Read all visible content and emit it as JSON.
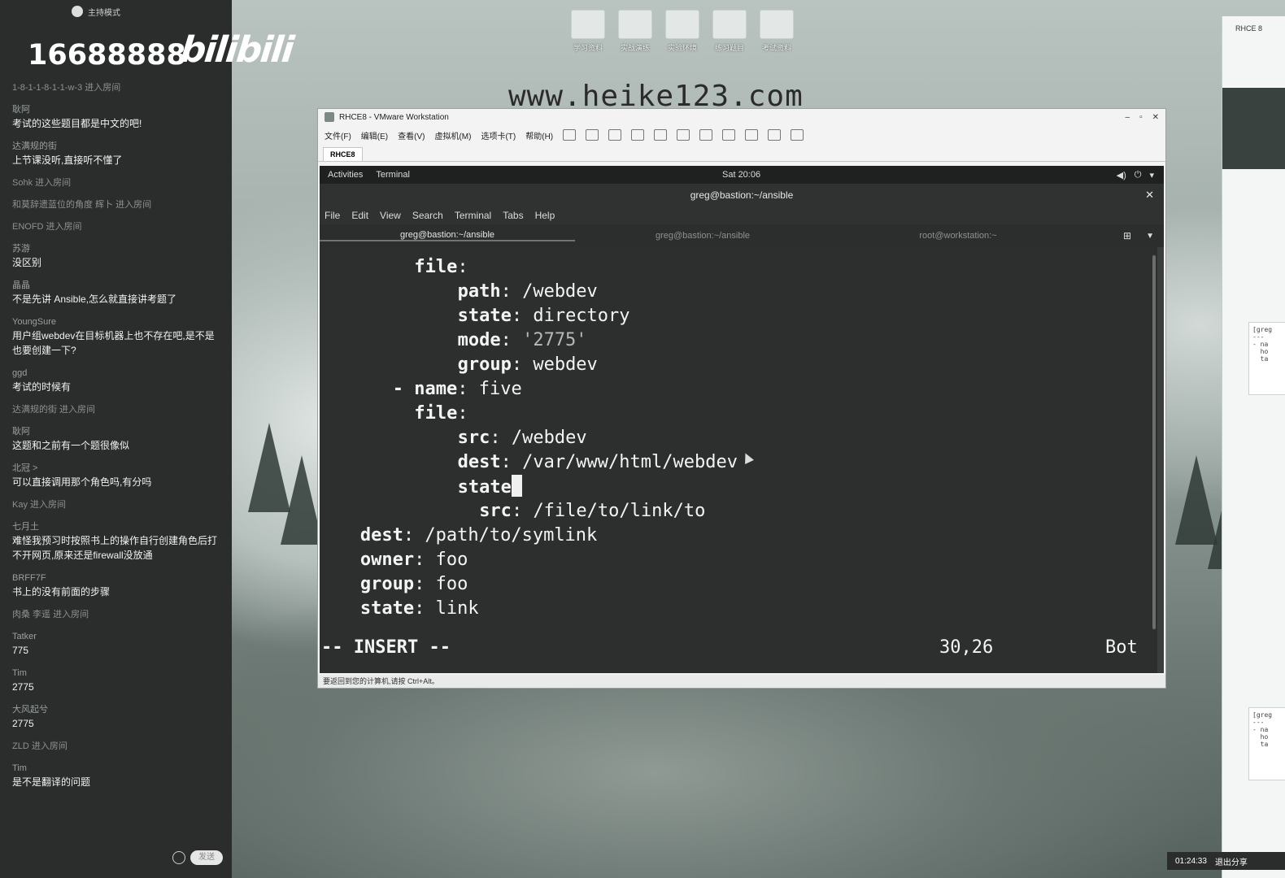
{
  "overlay": {
    "number": "16688888",
    "logo": "bilibili",
    "watermark": "www.heike123.com"
  },
  "chat_panel": {
    "top_title": "主持模式",
    "messages": [
      {
        "user": "1-8-1-1-8-1-1-w-3 进入房间",
        "text": ""
      },
      {
        "user": "耿阿",
        "text": "考试的这些题目都是中文的吧!"
      },
      {
        "user": "达满规的街",
        "text": "上节课没听,直接听不懂了"
      },
      {
        "user": "Sohk 进入房间",
        "text": ""
      },
      {
        "user": "和莫辞遗蓝位的角度 辉卜 进入房间",
        "text": ""
      },
      {
        "user": "ENOFD 进入房间",
        "text": ""
      },
      {
        "user": "苏游",
        "text": "没区别"
      },
      {
        "user": "晶晶",
        "text": "不是先讲 Ansible,怎么就直接讲考题了"
      },
      {
        "user": "YoungSure",
        "text": "用户组webdev在目标机器上也不存在吧,是不是也要创建一下?"
      },
      {
        "user": "ggd",
        "text": "考试的时候有"
      },
      {
        "user": "达满规的街 进入房间",
        "text": ""
      },
      {
        "user": "耿阿",
        "text": "这题和之前有一个题很像似"
      },
      {
        "user": "北冠 >",
        "text": "可以直接调用那个角色吗,有分吗"
      },
      {
        "user": "Kay 进入房间",
        "text": ""
      },
      {
        "user": "七月土",
        "text": "难怪我预习时按照书上的操作自行创建角色后打不开网页,原来还是firewall没放通"
      },
      {
        "user": "BRFF7F",
        "text": "书上的没有前面的步骤"
      },
      {
        "user": "肉桑 李遥 进入房间",
        "text": ""
      },
      {
        "user": "Tatker",
        "text": "775"
      },
      {
        "user": "Tim",
        "text": "2775"
      },
      {
        "user": "大风起兮",
        "text": "2775"
      },
      {
        "user": "ZLD 进入房间",
        "text": ""
      },
      {
        "user": "Tim",
        "text": "是不是翻译的问题"
      }
    ],
    "send_label": "发送"
  },
  "desktop_icons": [
    "学习资料",
    "实战演练",
    "实验环境",
    "练习题目",
    "考试资料"
  ],
  "right_panel": {
    "tab_label": "RHCE 8",
    "code_snippet_1": "[greg\n---\n- na\n  ho\n  ta",
    "code_snippet_2": "[greg\n---\n- na\n  ho\n  ta",
    "clock": "01:24:33",
    "share_label": "退出分享"
  },
  "vmware": {
    "title": "RHCE8 - VMware Workstation",
    "menu": [
      "文件(F)",
      "编辑(E)",
      "查看(V)",
      "虚拟机(M)",
      "选项卡(T)",
      "帮助(H)"
    ],
    "tab": "RHCE8",
    "status": "要返回到您的计算机,请按 Ctrl+Alt。"
  },
  "gnome": {
    "activities": "Activities",
    "app_menu": "Terminal",
    "clock": "Sat 20:06"
  },
  "terminal": {
    "window_title": "greg@bastion:~/ansible",
    "menu": [
      "File",
      "Edit",
      "View",
      "Search",
      "Terminal",
      "Tabs",
      "Help"
    ],
    "tabs": [
      "greg@bastion:~/ansible",
      "greg@bastion:~/ansible",
      "root@workstation:~"
    ],
    "lines": [
      {
        "key": "file",
        "sep": ":",
        "val": ""
      },
      {
        "key": "path",
        "sep": ": ",
        "val": "/webdev"
      },
      {
        "key": "state",
        "sep": ": ",
        "val": "directory"
      },
      {
        "key": "mode",
        "sep": ": ",
        "val": "'2775'"
      },
      {
        "key": "group",
        "sep": ": ",
        "val": "webdev"
      },
      {
        "key": "- name",
        "sep": ": ",
        "val": "five"
      },
      {
        "key": "file",
        "sep": ":",
        "val": ""
      },
      {
        "key": "src",
        "sep": ": ",
        "val": "/webdev"
      },
      {
        "key": "dest",
        "sep": ": ",
        "val": "/var/www/html/webdev"
      },
      {
        "key": "state",
        "sep": "",
        "val": ""
      },
      {
        "key": "src",
        "sep": ": ",
        "val": "/file/to/link/to"
      },
      {
        "key": "dest",
        "sep": ": ",
        "val": "/path/to/symlink"
      },
      {
        "key": "owner",
        "sep": ": ",
        "val": "foo"
      },
      {
        "key": "group",
        "sep": ": ",
        "val": "foo"
      },
      {
        "key": "state",
        "sep": ": ",
        "val": "link"
      }
    ],
    "mode": "-- INSERT --",
    "position": "30,26",
    "scroll": "Bot"
  }
}
